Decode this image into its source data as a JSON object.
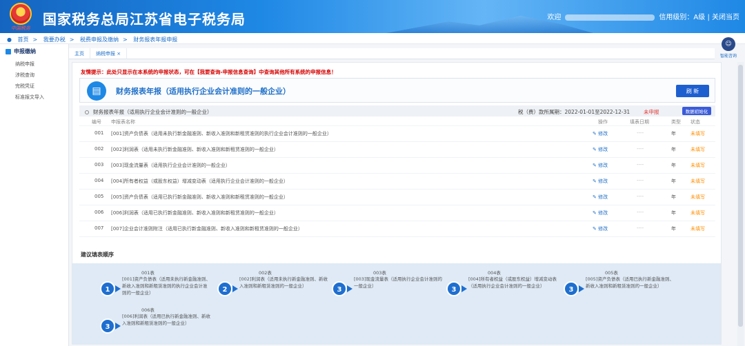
{
  "header": {
    "site_title": "国家税务总局江苏省电子税务局",
    "emblem_caption": "中国税务",
    "welcome": "欢迎",
    "credit": "信用级别：A级",
    "close_label": "关闭当页"
  },
  "breadcrumb": [
    "首页",
    "我要办税",
    "税费申报及缴纳",
    "财务报表年报申报"
  ],
  "sidebar": {
    "group": "申报缴纳",
    "items": [
      "纳税申报",
      "涉税查询",
      "完税凭证",
      "标准报文导入"
    ]
  },
  "tabs": [
    "主页",
    "纳税申报 ×"
  ],
  "help": "智能咨询",
  "tip": "友情提示：此处只显示在本系统的申报状态，可在【我要查询-申报信息查询】中查询其他所有系统的申报信息！",
  "report": {
    "title": "财务报表年报（适用执行企业会计准则的一般企业）",
    "refresh": "刷 新"
  },
  "section": {
    "label": "财务报表年报（适用执行企业会计准则的一般企业）",
    "period": "税（费）款所属期：2022-01-01至2022-12-31",
    "status": "未申报",
    "init_button": "数据初始化"
  },
  "table": {
    "headers": {
      "no": "编号",
      "name": "申报表名称",
      "op": "操作",
      "date": "填表日期",
      "type": "类型",
      "status": "状态"
    },
    "rows": [
      {
        "no": "001",
        "name": "[001]资产负债表（适用未执行新金融准则、新收入准则和新租赁准则的执行企业会计准则的一般企业）",
        "op": "修改",
        "date": "----",
        "type": "年",
        "status": "未填写"
      },
      {
        "no": "002",
        "name": "[002]利润表（适用未执行新金融准则、新收入准则和新租赁准则的一般企业）",
        "op": "修改",
        "date": "----",
        "type": "年",
        "status": "未填写"
      },
      {
        "no": "003",
        "name": "[003]现金流量表（适用执行企业会计准则的一般企业）",
        "op": "修改",
        "date": "----",
        "type": "年",
        "status": "未填写"
      },
      {
        "no": "004",
        "name": "[004]所有者权益（或股东权益）增减变动表（适用执行企业会计准则的一般企业）",
        "op": "修改",
        "date": "----",
        "type": "年",
        "status": "未填写"
      },
      {
        "no": "005",
        "name": "[005]资产负债表（适用已执行新金融准则、新收入准则和新租赁准则的一般企业）",
        "op": "修改",
        "date": "----",
        "type": "年",
        "status": "未填写"
      },
      {
        "no": "006",
        "name": "[006]利润表（适用已执行新金融准则、新收入准则和新租赁准则的一般企业）",
        "op": "修改",
        "date": "----",
        "type": "年",
        "status": "未填写"
      },
      {
        "no": "007",
        "name": "[007]企业会计准则附注（适用已执行新金融准则、新收入准则和新租赁准则的一般企业）",
        "op": "修改",
        "date": "----",
        "type": "年",
        "status": "未填写"
      }
    ]
  },
  "order": {
    "title": "建议填表顺序",
    "steps": [
      {
        "num": "1",
        "name": "001表",
        "desc": "[001]资产负债表（适用未执行新金融准则、新收入准则和新租赁准则的执行企业会计准则的一般企业）"
      },
      {
        "num": "2",
        "name": "002表",
        "desc": "[002]利润表（适用未执行新金融准则、新收入准则和新租赁准则的一般企业）"
      },
      {
        "num": "3",
        "name": "003表",
        "desc": "[003]现金流量表（适用执行企业会计准则的一般企业）"
      },
      {
        "num": "3",
        "name": "004表",
        "desc": "[004]所有者权益（或股东权益）增减变动表（适用执行企业会计准则的一般企业）"
      },
      {
        "num": "3",
        "name": "005表",
        "desc": "[005]资产负债表（适用已执行新金融准则、新收入准则和新租赁准则的一般企业）"
      },
      {
        "num": "3",
        "name": "006表",
        "desc": "[006]利润表（适用已执行新金融准则、新收入准则和新租赁准则的一般企业）"
      }
    ]
  }
}
